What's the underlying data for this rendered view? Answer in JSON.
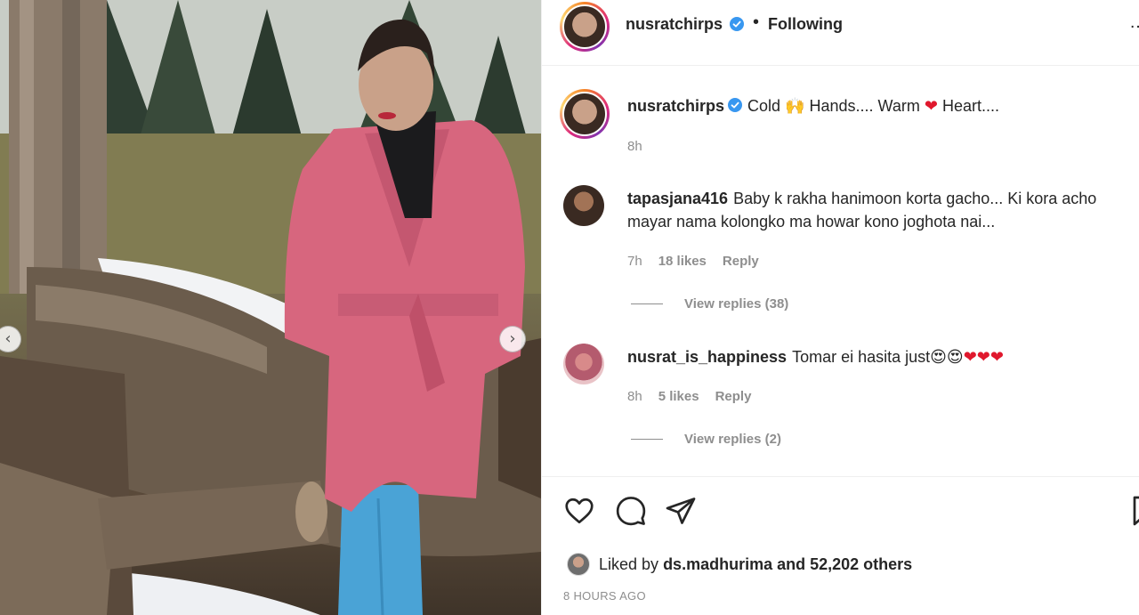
{
  "post": {
    "username": "nusratchirps",
    "follow_status": "Following",
    "separator": "•",
    "more": "…"
  },
  "caption": {
    "username": "nusratchirps",
    "text_1": "Cold",
    "emoji_1": "🙌",
    "text_2": "Hands.... Warm",
    "emoji_2": "❤",
    "text_3": "Heart....",
    "time": "8h"
  },
  "comments": [
    {
      "username": "tapasjana416",
      "text": "Baby k rakha hanimoon korta gacho... Ki kora acho mayar nama kolongko ma howar kono joghota nai...",
      "time": "7h",
      "likes": "18 likes",
      "reply": "Reply",
      "view_replies": "View replies (38)"
    },
    {
      "username": "nusrat_is_happiness",
      "text": "Tomar ei hasita just",
      "emojis": "😍😍",
      "hearts": "❤❤❤",
      "time": "8h",
      "likes": "5 likes",
      "reply": "Reply",
      "view_replies": "View replies (2)"
    }
  ],
  "liked_by": {
    "prefix": "Liked by",
    "user": "ds.madhurima",
    "suffix": "and 52,202 others"
  },
  "timestamp": "8 HOURS AGO",
  "carousel": {
    "prev": "‹",
    "next": "›"
  },
  "colors": {
    "verified": "#3897f0",
    "heart": "#e0182d",
    "muted": "#8e8e8e",
    "coat": "#d7667e",
    "jeans": "#4aa3d6"
  }
}
